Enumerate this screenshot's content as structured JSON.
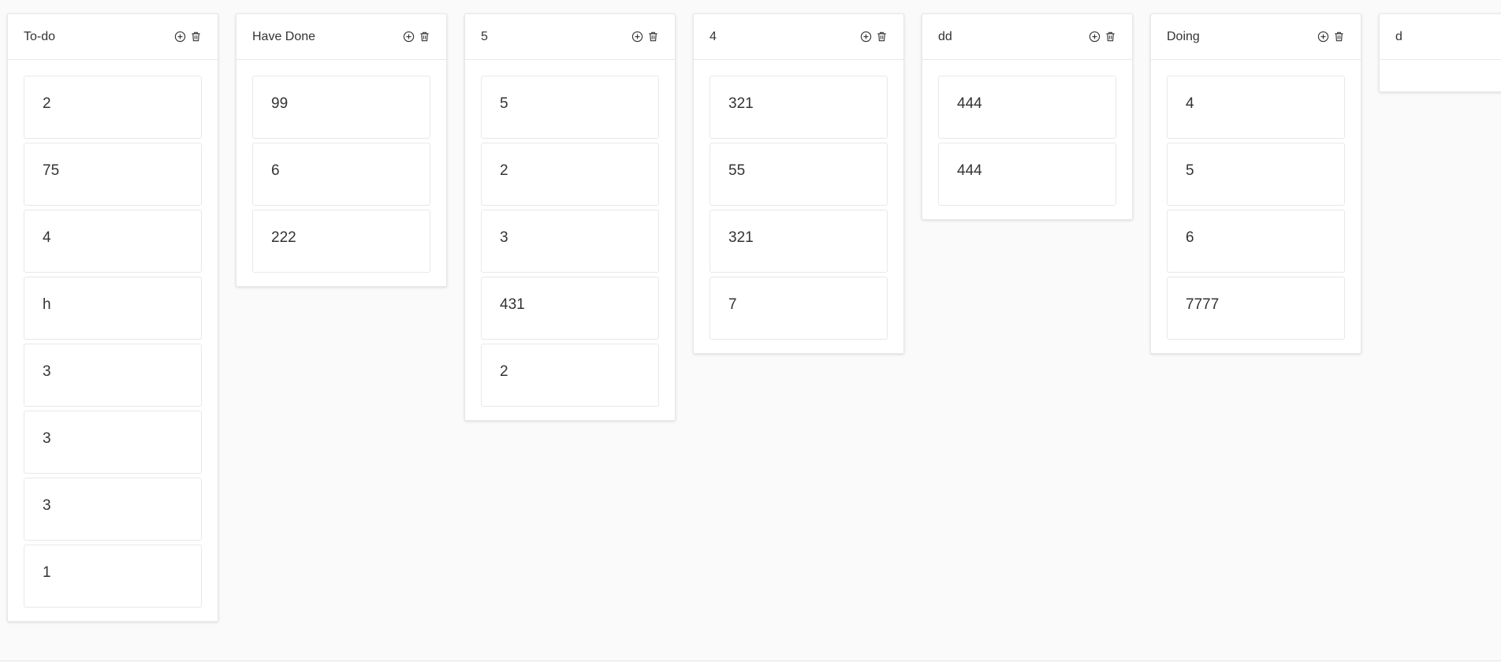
{
  "columns": [
    {
      "title": "To-do",
      "cards": [
        "2",
        "75",
        "4",
        "h",
        "3",
        "3",
        "3",
        "1"
      ]
    },
    {
      "title": "Have Done",
      "cards": [
        "99",
        "6",
        "222"
      ]
    },
    {
      "title": "5",
      "cards": [
        "5",
        "2",
        "3",
        "431",
        "2"
      ]
    },
    {
      "title": "4",
      "cards": [
        "321",
        "55",
        "321",
        "7"
      ]
    },
    {
      "title": "dd",
      "cards": [
        "444",
        "444"
      ]
    },
    {
      "title": "Doing",
      "cards": [
        "4",
        "5",
        "6",
        "7777"
      ]
    },
    {
      "title": "d",
      "cards": []
    }
  ],
  "icons": {
    "add": "circle-plus-icon",
    "delete": "trash-icon"
  },
  "colors": {
    "background": "#fafafa",
    "panel": "#ffffff",
    "border": "#e8e8e8",
    "text": "#333333"
  }
}
